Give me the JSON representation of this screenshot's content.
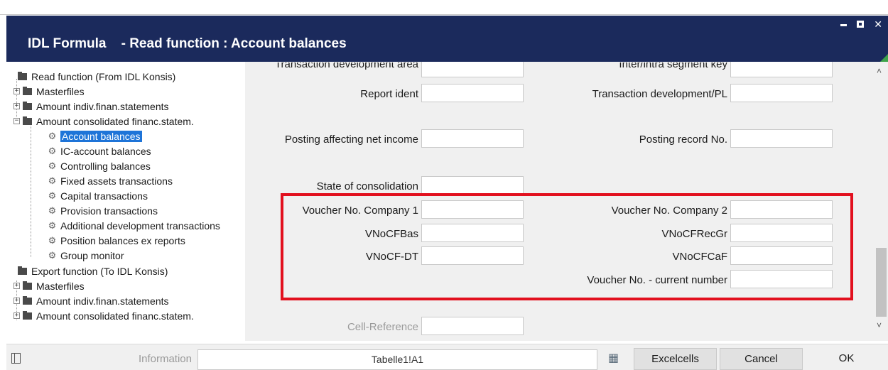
{
  "window": {
    "title": "IDL Formula    - Read function : Account balances",
    "controls": {
      "minimize": "–",
      "maximize": "□",
      "close": "✕"
    }
  },
  "tree": {
    "items": [
      {
        "label": "Read function (From IDL Konsis)",
        "type": "root"
      },
      {
        "label": "Masterfiles",
        "type": "folder"
      },
      {
        "label": "Amount indiv.finan.statements",
        "type": "folder"
      },
      {
        "label": "Amount consolidated financ.statem.",
        "type": "folder-open"
      },
      {
        "label": "Account balances",
        "type": "leaf",
        "selected": true
      },
      {
        "label": "IC-account balances",
        "type": "leaf"
      },
      {
        "label": "Controlling balances",
        "type": "leaf"
      },
      {
        "label": "Fixed assets transactions",
        "type": "leaf"
      },
      {
        "label": "Capital transactions",
        "type": "leaf"
      },
      {
        "label": "Provision transactions",
        "type": "leaf"
      },
      {
        "label": "Additional development transactions",
        "type": "leaf"
      },
      {
        "label": "Position balances ex reports",
        "type": "leaf"
      },
      {
        "label": "Group monitor",
        "type": "leaf"
      },
      {
        "label": "Export function (To IDL Konsis)",
        "type": "root"
      },
      {
        "label": "Masterfiles",
        "type": "folder"
      },
      {
        "label": "Amount indiv.finan.statements",
        "type": "folder"
      },
      {
        "label": "Amount consolidated financ.statem.",
        "type": "folder"
      }
    ]
  },
  "form": {
    "left": [
      {
        "label": "Transaction development area",
        "value": ""
      },
      {
        "label": "Report ident",
        "value": ""
      },
      {
        "label": "Posting affecting net income",
        "value": ""
      },
      {
        "label": "State of consolidation",
        "value": ""
      },
      {
        "label": "Voucher No. Company 1",
        "value": ""
      },
      {
        "label": "VNoCFBas",
        "value": ""
      },
      {
        "label": "VNoCF-DT",
        "value": ""
      },
      {
        "label": "Cell-Reference",
        "value": ""
      }
    ],
    "right": [
      {
        "label": "Inter/intra segment key",
        "value": ""
      },
      {
        "label": "Transaction development/PL",
        "value": ""
      },
      {
        "label": "Posting record No.",
        "value": ""
      },
      {
        "label": "Voucher No. Company 2",
        "value": ""
      },
      {
        "label": "VNoCFRecGr",
        "value": ""
      },
      {
        "label": "VNoCFCaF",
        "value": ""
      },
      {
        "label": "Voucher No. - current number",
        "value": ""
      }
    ]
  },
  "bottom": {
    "info_label": "Information",
    "info_value": "Tabelle1!A1",
    "excelcells_label": "Excelcells",
    "cancel_label": "Cancel",
    "ok_label": "OK"
  },
  "colors": {
    "titlebar": "#1b2a5c",
    "selection": "#1e74d8",
    "highlight_box": "#e2101e",
    "accent_green": "#3ea34a"
  }
}
